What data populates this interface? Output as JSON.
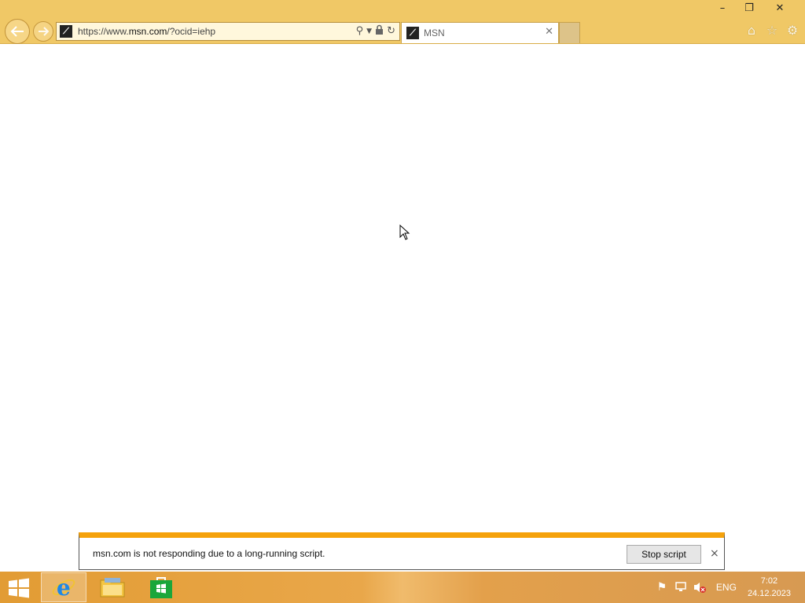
{
  "browser": {
    "address": {
      "url_prefix": "https://www.",
      "url_domain": "msn.com",
      "url_suffix": "/?ocid=iehp"
    },
    "tab": {
      "title": "MSN"
    },
    "window_controls": {
      "minimize": "–",
      "restore": "❐",
      "close": "✕"
    },
    "toolbar_icons": [
      "home-icon",
      "favorites-star-icon",
      "settings-gear-icon"
    ]
  },
  "notification": {
    "message": "msn.com is not responding due to a long-running script.",
    "stop_button": "Stop script",
    "close": "×",
    "accent_color": "#f5a20b"
  },
  "taskbar": {
    "pinned": [
      "internet-explorer",
      "file-explorer",
      "store"
    ],
    "language": "ENG",
    "time": "7:02",
    "date": "24.12.2023"
  }
}
